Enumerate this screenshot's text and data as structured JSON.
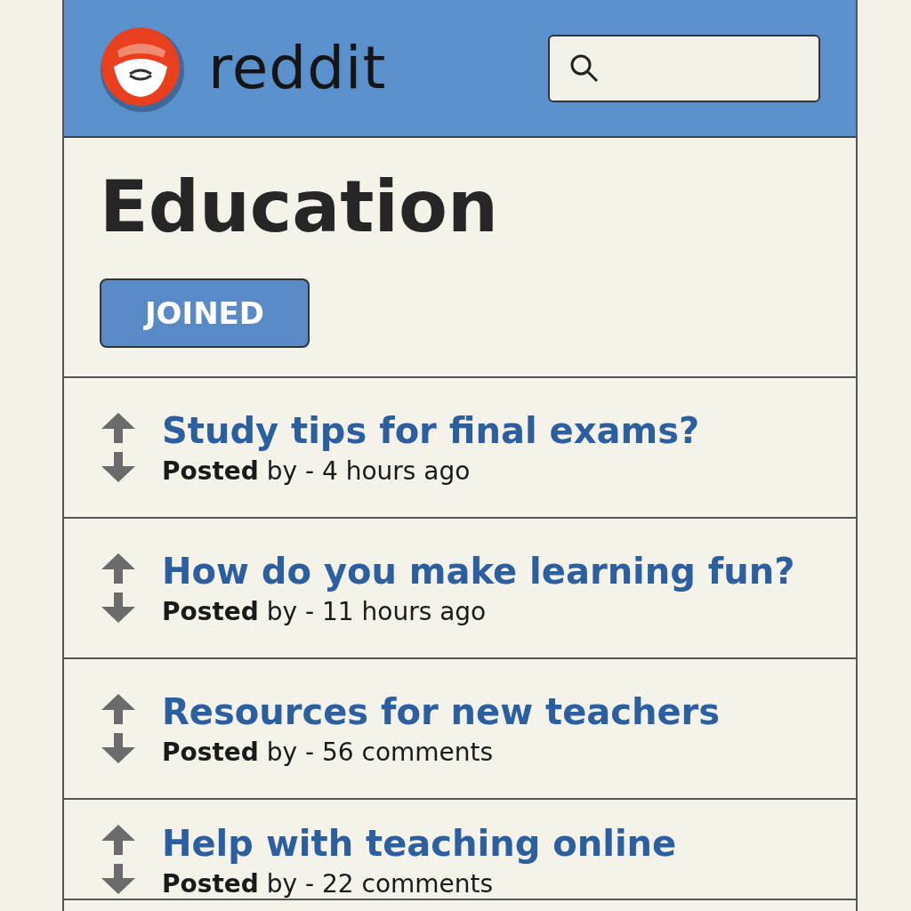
{
  "header": {
    "brand": "reddit"
  },
  "community": {
    "title": "Education",
    "join_button": {
      "label": "JOINED",
      "joined": true
    }
  },
  "posts": [
    {
      "title": "Study tips for final exams?",
      "meta": "**Posted** by - 4 hours ago"
    },
    {
      "title": "How do you make learning fun?",
      "meta": "**Posted** by - 11 hours ago"
    },
    {
      "title": "Resources for new teachers",
      "meta": "**Posted** by - 56 comments"
    },
    {
      "title": "Help with teaching online",
      "meta": "**Posted** by - 22 comments"
    }
  ]
}
